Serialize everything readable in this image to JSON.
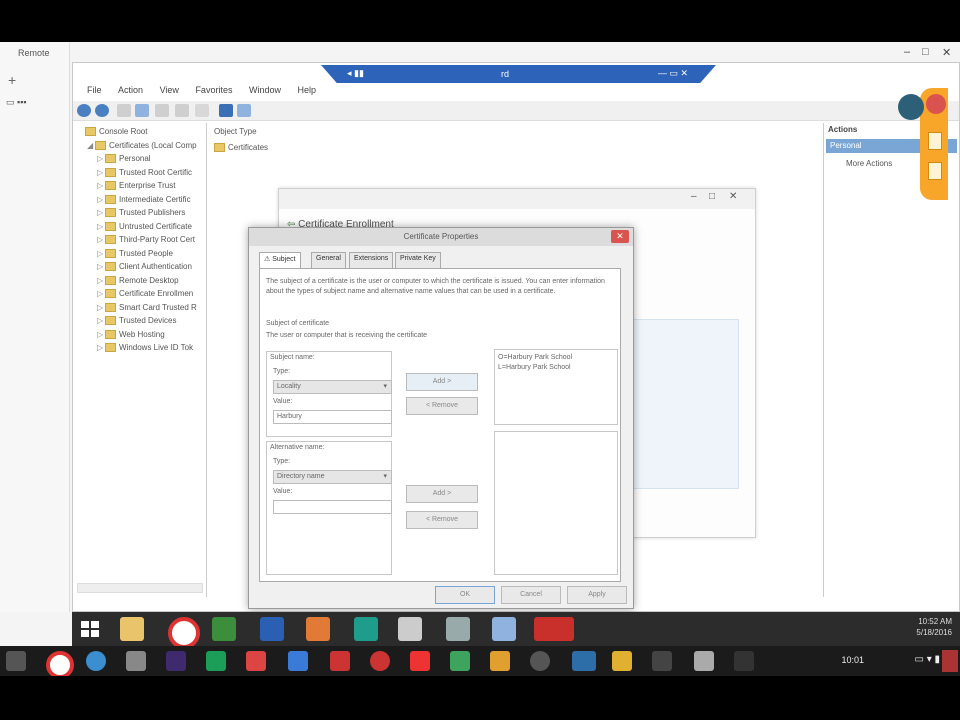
{
  "outer": {
    "title": "Remote"
  },
  "rd_bar": {
    "title": "rd"
  },
  "mmc": {
    "menu": [
      "File",
      "Action",
      "View",
      "Favorites",
      "Window",
      "Help"
    ],
    "tree": [
      {
        "label": "Console Root",
        "level": 0
      },
      {
        "label": "Certificates (Local Comp",
        "level": 1
      },
      {
        "label": "Personal",
        "level": 2
      },
      {
        "label": "Trusted Root Certific",
        "level": 2
      },
      {
        "label": "Enterprise Trust",
        "level": 2
      },
      {
        "label": "Intermediate Certific",
        "level": 2
      },
      {
        "label": "Trusted Publishers",
        "level": 2
      },
      {
        "label": "Untrusted Certificate",
        "level": 2
      },
      {
        "label": "Third-Party Root Cert",
        "level": 2
      },
      {
        "label": "Trusted People",
        "level": 2
      },
      {
        "label": "Client Authentication",
        "level": 2
      },
      {
        "label": "Remote Desktop",
        "level": 2
      },
      {
        "label": "Certificate Enrollmen",
        "level": 2
      },
      {
        "label": "Smart Card Trusted R",
        "level": 2
      },
      {
        "label": "Trusted Devices",
        "level": 2
      },
      {
        "label": "Web Hosting",
        "level": 2
      },
      {
        "label": "Windows Live ID Tok",
        "level": 2
      }
    ],
    "middle": {
      "header": "Object Type",
      "item": "Certificates"
    },
    "actions": {
      "header": "Actions",
      "selected": "Personal",
      "more": "More Actions"
    }
  },
  "wizard": {
    "title": "Certificate Enrollment"
  },
  "props": {
    "title": "Certificate Properties",
    "tabs": [
      "Subject",
      "General",
      "Extensions",
      "Private Key"
    ],
    "intro": "The subject of a certificate is the user or computer to which the certificate is issued. You can enter information about the types of subject name and alternative name values that can be used in a certificate.",
    "subject_heading": "Subject of certificate",
    "subject_desc": "The user or computer that is receiving the certificate",
    "subject_name_label": "Subject name:",
    "type_label": "Type:",
    "type_value": "Locality",
    "value_label": "Value:",
    "value_value": "Harbury",
    "alt_name_label": "Alternative name:",
    "alt_type_label": "Type:",
    "alt_type_value": "Directory name",
    "alt_value_label": "Value:",
    "add_label": "Add >",
    "remove_label": "< Remove",
    "add2_label": "Add >",
    "remove2_label": "< Remove",
    "list_lines": [
      "O=Harbury Park School",
      "L=Harbury Park School"
    ],
    "ok": "OK",
    "cancel": "Cancel",
    "apply": "Apply"
  },
  "taskbar": {
    "tray_time": "10:52",
    "tray_ampm": "AM",
    "tray_date": "5/18/2016"
  },
  "shelf": {
    "time": "10:01"
  }
}
